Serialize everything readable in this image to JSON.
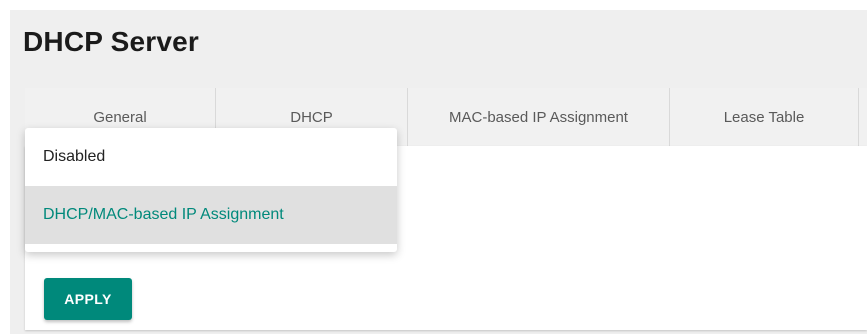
{
  "page": {
    "title": "DHCP Server"
  },
  "tabs": [
    {
      "label": "General"
    },
    {
      "label": "DHCP"
    },
    {
      "label": "MAC-based IP Assignment"
    },
    {
      "label": "Lease Table"
    }
  ],
  "dropdown": {
    "options": [
      {
        "label": "Disabled",
        "selected": false
      },
      {
        "label": "DHCP/MAC-based IP Assignment",
        "selected": true
      }
    ]
  },
  "actions": {
    "apply_label": "APPLY"
  },
  "colors": {
    "accent": "#00897b",
    "background": "#efefef",
    "selected_option_background": "#e0e0e0"
  }
}
